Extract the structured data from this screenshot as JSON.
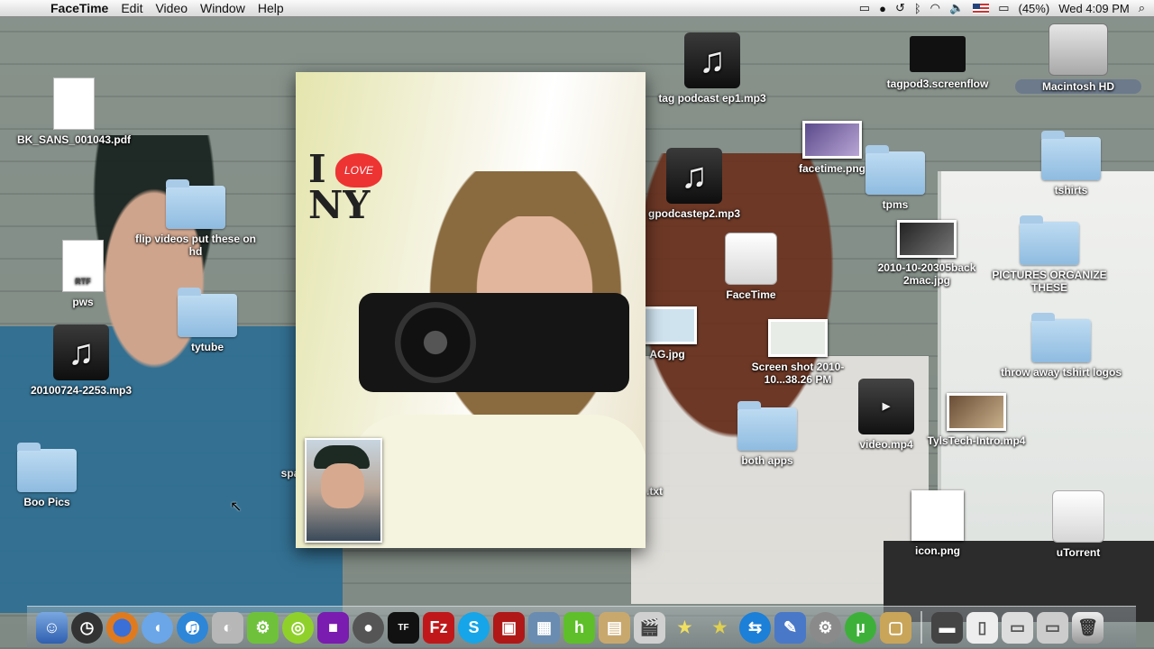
{
  "menubar": {
    "apple": "",
    "app_name": "FaceTime",
    "menus": [
      "Edit",
      "Video",
      "Window",
      "Help"
    ],
    "battery": "(45%)",
    "clock": "Wed 4:09 PM"
  },
  "desktop": {
    "icons": [
      {
        "label": "BK_SANS_001043.pdf"
      },
      {
        "label": "flip videos put these on hd"
      },
      {
        "label": "pws",
        "doc_tag": "RTF"
      },
      {
        "label": "tytube"
      },
      {
        "label": "20100724-2253.mp3"
      },
      {
        "label": "Boo Pics"
      },
      {
        "label": "tag podcast ep1.mp3"
      },
      {
        "label": "gpodcastep2.mp3"
      },
      {
        "label": "tagpod3.screenflow"
      },
      {
        "label": "Macintosh HD"
      },
      {
        "label": "facetime.png"
      },
      {
        "label": "tpms"
      },
      {
        "label": "tshirts"
      },
      {
        "label": "FaceTime"
      },
      {
        "label": "2010-10-20305back 2mac.jpg"
      },
      {
        "label": "PICTURES ORGANIZE THESE"
      },
      {
        "label": "AG.jpg"
      },
      {
        "label": "Screen shot 2010-10...38.26 PM"
      },
      {
        "label": "throw away tshirt logos"
      },
      {
        "label": "video.mp4"
      },
      {
        "label": "TylsTech-Intro.mp4"
      },
      {
        "label": "both apps"
      },
      {
        "label": ".txt"
      },
      {
        "label": "spa"
      },
      {
        "label": "icon.png"
      },
      {
        "label": "uTorrent"
      }
    ]
  },
  "facetime": {
    "sign_i": "I",
    "sign_love": "LOVE",
    "sign_ny": "NY"
  },
  "dock": {
    "items": [
      "finder-icon",
      "dashboard-icon",
      "firefox-icon",
      "ichat-icon",
      "itunes-icon",
      "preview-icon",
      "tangled-icon",
      "spiral-icon",
      "purple-app-icon",
      "webcam-icon",
      "toll-free-icon",
      "filezilla-icon",
      "skype-icon",
      "photo-app-icon",
      "window-app-icon",
      "hulu-icon",
      "screenshot-icon",
      "movie-icon",
      "star-icon",
      "star2-icon",
      "teamviewer-icon",
      "utility-icon",
      "settings-icon",
      "utorrent-icon",
      "stack-icon",
      "folder-stack-icon",
      "document-stack-icon",
      "window-stack-icon",
      "window2-stack-icon",
      "trash-icon"
    ]
  }
}
